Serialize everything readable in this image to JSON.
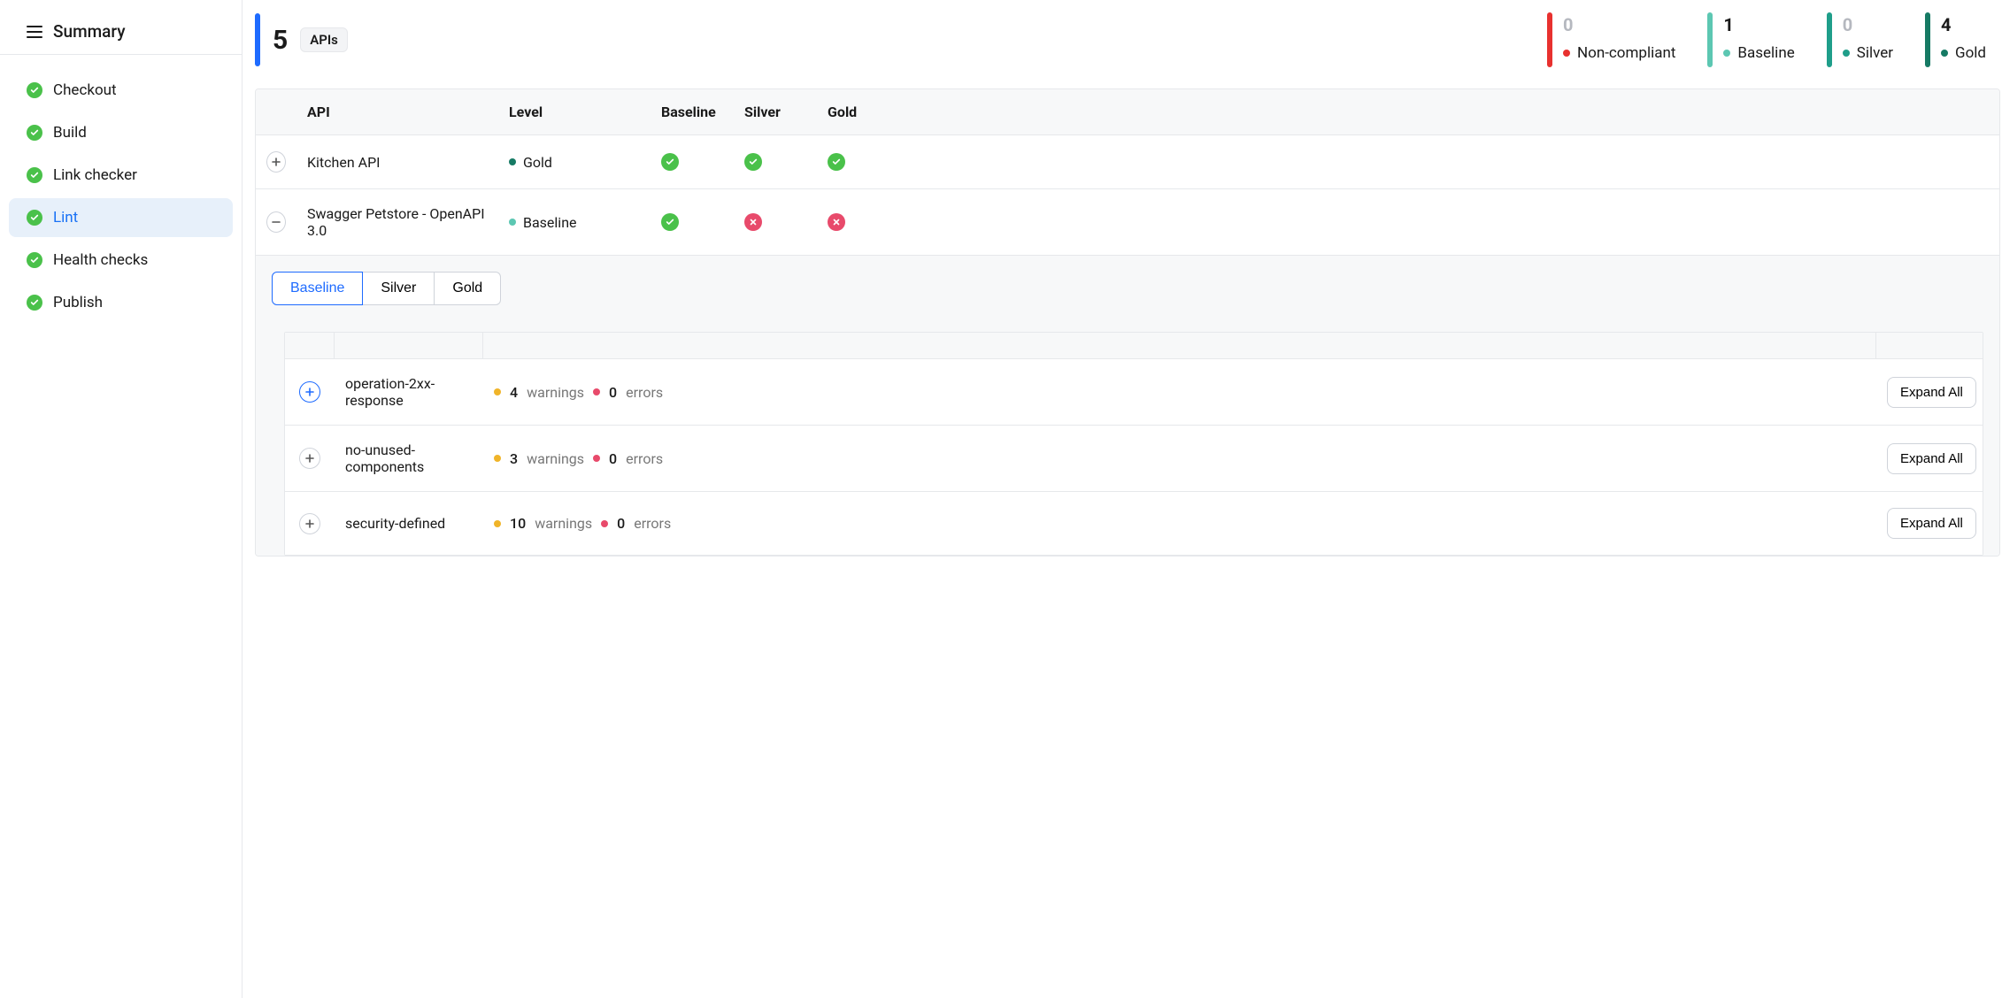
{
  "sidebar": {
    "title": "Summary",
    "items": [
      {
        "label": "Checkout"
      },
      {
        "label": "Build"
      },
      {
        "label": "Link checker"
      },
      {
        "label": "Lint"
      },
      {
        "label": "Health checks"
      },
      {
        "label": "Publish"
      }
    ],
    "activeIndex": 3
  },
  "stats": {
    "total": {
      "value": "5",
      "chip": "APIs"
    },
    "items": [
      {
        "value": "0",
        "label": "Non-compliant",
        "barColor": "#e8312f",
        "dotColor": "#e8312f",
        "muted": true
      },
      {
        "value": "1",
        "label": "Baseline",
        "barColor": "#5cc7b2",
        "dotColor": "#5cc7b2",
        "muted": false
      },
      {
        "value": "0",
        "label": "Silver",
        "barColor": "#1f9e8a",
        "dotColor": "#1f9e8a",
        "muted": true
      },
      {
        "value": "4",
        "label": "Gold",
        "barColor": "#167a64",
        "dotColor": "#167a64",
        "muted": false
      }
    ]
  },
  "table": {
    "headers": {
      "api": "API",
      "level": "Level",
      "baseline": "Baseline",
      "silver": "Silver",
      "gold": "Gold"
    },
    "rows": [
      {
        "expanded": false,
        "api": "Kitchen API",
        "level": {
          "label": "Gold",
          "color": "#167a64"
        },
        "baseline": "ok",
        "silver": "ok",
        "gold": "ok"
      },
      {
        "expanded": true,
        "api": "Swagger Petstore - OpenAPI 3.0",
        "level": {
          "label": "Baseline",
          "color": "#5cc7b2"
        },
        "baseline": "ok",
        "silver": "fail",
        "gold": "fail"
      }
    ]
  },
  "detail": {
    "tabs": [
      {
        "label": "Baseline",
        "active": true
      },
      {
        "label": "Silver",
        "active": false
      },
      {
        "label": "Gold",
        "active": false
      }
    ],
    "rules": [
      {
        "name": "operation-2xx-response",
        "warnings": 4,
        "errors": 0,
        "warnLabel": "warnings",
        "errLabel": "errors",
        "action": "Expand All",
        "blueExp": true
      },
      {
        "name": "no-unused-components",
        "warnings": 3,
        "errors": 0,
        "warnLabel": "warnings",
        "errLabel": "errors",
        "action": "Expand All",
        "blueExp": false
      },
      {
        "name": "security-defined",
        "warnings": 10,
        "errors": 0,
        "warnLabel": "warnings",
        "errLabel": "errors",
        "action": "Expand All",
        "blueExp": false
      }
    ]
  },
  "colors": {
    "warning": "#f0b429",
    "error": "#e84a6b"
  }
}
